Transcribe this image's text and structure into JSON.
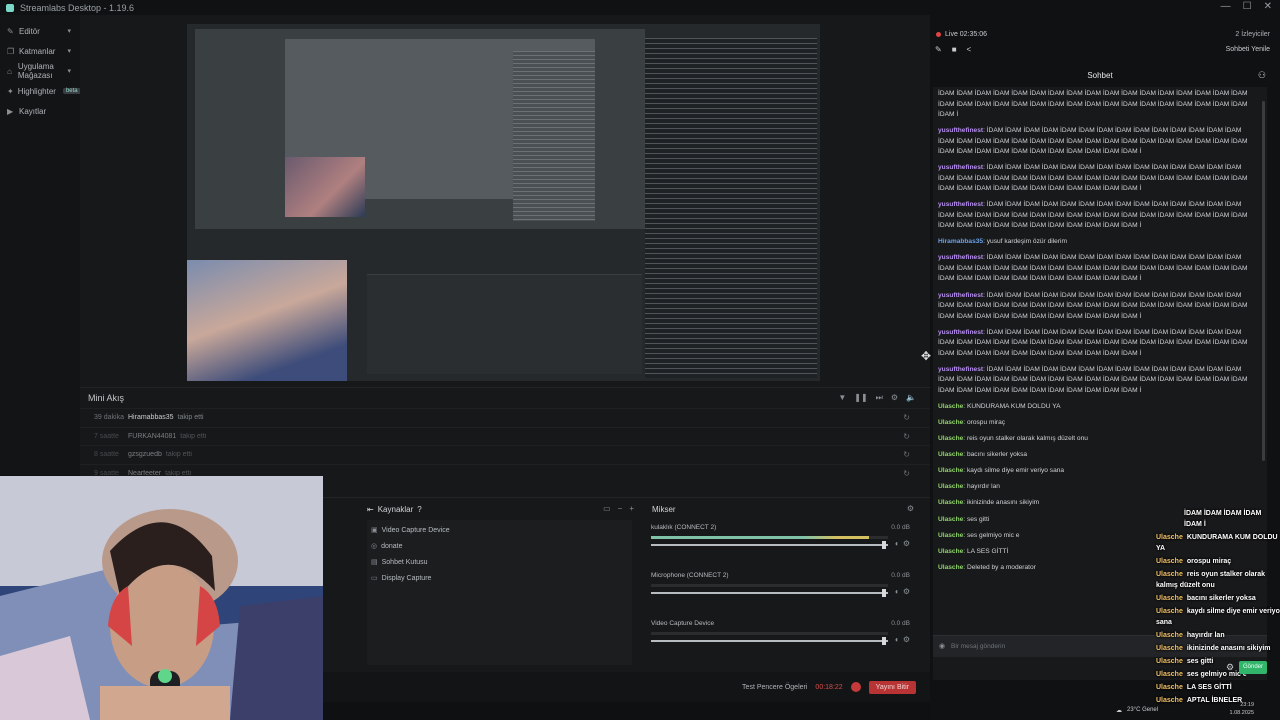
{
  "window": {
    "title": "Streamlabs Desktop - 1.19.6",
    "controls": [
      "—",
      "☐",
      "✕"
    ]
  },
  "nav": {
    "items": [
      {
        "label": "Editör",
        "icon": "pencil-icon",
        "chevron": true
      },
      {
        "label": "Katmanlar",
        "icon": "layers-icon",
        "chevron": true
      },
      {
        "label": "Uygulama Mağazası",
        "icon": "store-icon",
        "chevron": true
      },
      {
        "label": "Highlighter",
        "icon": "highlighter-icon",
        "badge": "beta"
      },
      {
        "label": "Kayıtlar",
        "icon": "recordings-icon"
      }
    ]
  },
  "minifeed": {
    "title": "Mini Akış",
    "rows": [
      {
        "time": "39 dakika",
        "name": "Hiramabbas35",
        "action": "takip etti"
      },
      {
        "time": "7 saatte",
        "name": "FURKAN44081",
        "action": "takip etti"
      },
      {
        "time": "8 saatte",
        "name": "gzsgzuedb",
        "action": "takip etti"
      },
      {
        "time": "9 saatte",
        "name": "Nearfeeter",
        "action": "takip etti"
      }
    ]
  },
  "sources": {
    "title": "Kaynaklar",
    "items": [
      {
        "label": "Video Capture Device",
        "icon": "camera-icon"
      },
      {
        "label": "donate",
        "icon": "donate-icon"
      },
      {
        "label": "Sohbet Kutusu",
        "icon": "chat-icon"
      },
      {
        "label": "Display Capture",
        "icon": "monitor-icon"
      }
    ]
  },
  "mixer": {
    "title": "Mikser",
    "channels": [
      {
        "label": "kulaklık (CONNECT 2)",
        "db": "0.0 dB",
        "level": 0.92
      },
      {
        "label": "Microphone (CONNECT 2)",
        "db": "0.0 dB",
        "level": 0.0
      },
      {
        "label": "Video Capture Device",
        "db": "0.0 dB",
        "level": 0.0
      }
    ]
  },
  "footer": {
    "test_label": "Test Pencere Ögeleri",
    "timer": "00:18:22",
    "end_label": "Yayını Bitir"
  },
  "chat": {
    "live": "Live 02:35:06",
    "viewers": "2 İzleyiciler",
    "refresh": "Sohbeti Yenile",
    "title": "Sohbet",
    "input_placeholder": "Bir mesaj gönderin",
    "messages": [
      {
        "user": "",
        "text": "İDAM İDAM İDAM İDAM İDAM İDAM İDAM İDAM İDAM İDAM İDAM İDAM İDAM İDAM İDAM İDAM İDAM İDAM İDAM İDAM İDAM İDAM İDAM İDAM İDAM İDAM İDAM İDAM İDAM İDAM İDAM İDAM İDAM İDAM İDAM İ",
        "color": "#d0d3d6"
      },
      {
        "user": "yusufthefinest",
        "text": ": İDAM İDAM İDAM İDAM İDAM İDAM İDAM İDAM İDAM İDAM İDAM İDAM İDAM İDAM İDAM İDAM İDAM İDAM İDAM İDAM İDAM İDAM İDAM İDAM İDAM İDAM İDAM İDAM İDAM İDAM İDAM İDAM İDAM İDAM İDAM İDAM İDAM İDAM İDAM İDAM İDAM İDAM İ",
        "color": "#b58cf0"
      },
      {
        "user": "yusufthefinest",
        "text": ": İDAM İDAM İDAM İDAM İDAM İDAM İDAM İDAM İDAM İDAM İDAM İDAM İDAM İDAM İDAM İDAM İDAM İDAM İDAM İDAM İDAM İDAM İDAM İDAM İDAM İDAM İDAM İDAM İDAM İDAM İDAM İDAM İDAM İDAM İDAM İDAM İDAM İDAM İDAM İDAM İDAM İDAM İ",
        "color": "#b58cf0"
      },
      {
        "user": "yusufthefinest",
        "text": ": İDAM İDAM İDAM İDAM İDAM İDAM İDAM İDAM İDAM İDAM İDAM İDAM İDAM İDAM İDAM İDAM İDAM İDAM İDAM İDAM İDAM İDAM İDAM İDAM İDAM İDAM İDAM İDAM İDAM İDAM İDAM İDAM İDAM İDAM İDAM İDAM İDAM İDAM İDAM İDAM İDAM İDAM İ",
        "color": "#b58cf0"
      },
      {
        "user": "Hiramabbas35",
        "text": ": yusuf kardeşim özür dilerim",
        "color": "#6aa3e8"
      },
      {
        "user": "yusufthefinest",
        "text": ": İDAM İDAM İDAM İDAM İDAM İDAM İDAM İDAM İDAM İDAM İDAM İDAM İDAM İDAM İDAM İDAM İDAM İDAM İDAM İDAM İDAM İDAM İDAM İDAM İDAM İDAM İDAM İDAM İDAM İDAM İDAM İDAM İDAM İDAM İDAM İDAM İDAM İDAM İDAM İDAM İDAM İDAM İ",
        "color": "#b58cf0"
      },
      {
        "user": "yusufthefinest",
        "text": ": İDAM İDAM İDAM İDAM İDAM İDAM İDAM İDAM İDAM İDAM İDAM İDAM İDAM İDAM İDAM İDAM İDAM İDAM İDAM İDAM İDAM İDAM İDAM İDAM İDAM İDAM İDAM İDAM İDAM İDAM İDAM İDAM İDAM İDAM İDAM İDAM İDAM İDAM İDAM İDAM İDAM İDAM İ",
        "color": "#b58cf0"
      },
      {
        "user": "yusufthefinest",
        "text": ": İDAM İDAM İDAM İDAM İDAM İDAM İDAM İDAM İDAM İDAM İDAM İDAM İDAM İDAM İDAM İDAM İDAM İDAM İDAM İDAM İDAM İDAM İDAM İDAM İDAM İDAM İDAM İDAM İDAM İDAM İDAM İDAM İDAM İDAM İDAM İDAM İDAM İDAM İDAM İDAM İDAM İDAM İ",
        "color": "#b58cf0"
      },
      {
        "user": "yusufthefinest",
        "text": ": İDAM İDAM İDAM İDAM İDAM İDAM İDAM İDAM İDAM İDAM İDAM İDAM İDAM İDAM İDAM İDAM İDAM İDAM İDAM İDAM İDAM İDAM İDAM İDAM İDAM İDAM İDAM İDAM İDAM İDAM İDAM İDAM İDAM İDAM İDAM İDAM İDAM İDAM İDAM İDAM İDAM İDAM İ",
        "color": "#b58cf0"
      },
      {
        "user": "Ulasche",
        "text": ": KUNDURAMA KUM DOLDU YA",
        "color": "#8fd36a"
      },
      {
        "user": "Ulasche",
        "text": ": orospu miraç",
        "color": "#8fd36a"
      },
      {
        "user": "Ulasche",
        "text": ": reis oyun stalker olarak kalmış düzelt onu",
        "color": "#8fd36a"
      },
      {
        "user": "Ulasche",
        "text": ": bacını sikerler yoksa",
        "color": "#8fd36a"
      },
      {
        "user": "Ulasche",
        "text": ": kaydı silme diye emir veriyo sana",
        "color": "#8fd36a"
      },
      {
        "user": "Ulasche",
        "text": ": hayırdır lan",
        "color": "#8fd36a"
      },
      {
        "user": "Ulasche",
        "text": ": ikinizinde anasını sikiyim",
        "color": "#8fd36a"
      },
      {
        "user": "Ulasche",
        "text": ": ses gitti",
        "color": "#8fd36a"
      },
      {
        "user": "Ulasche",
        "text": ": ses gelmiyo mic e",
        "color": "#8fd36a"
      },
      {
        "user": "Ulasche",
        "text": ": LA SES GİTTİ",
        "color": "#8fd36a"
      },
      {
        "user": "Ulasche",
        "text": ": Deleted by a moderator",
        "color": "#8fd36a"
      }
    ]
  },
  "overlay_chat": {
    "lead": "İDAM İDAM İDAM İDAM İDAM İ",
    "messages": [
      {
        "user": "Ulasche",
        "text": "KUNDURAMA KUM DOLDU YA"
      },
      {
        "user": "Ulasche",
        "text": "orospu miraç"
      },
      {
        "user": "Ulasche",
        "text": "reis oyun stalker olarak kalmış düzelt onu"
      },
      {
        "user": "Ulasche",
        "text": "bacını sikerler yoksa"
      },
      {
        "user": "Ulasche",
        "text": "kaydı silme diye emir veriyo sana"
      },
      {
        "user": "Ulasche",
        "text": "hayırdır lan"
      },
      {
        "user": "Ulasche",
        "text": "ikinizinde anasını sikiyim"
      },
      {
        "user": "Ulasche",
        "text": "ses gitti"
      },
      {
        "user": "Ulasche",
        "text": "ses gelmiyo mic e"
      },
      {
        "user": "Ulasche",
        "text": "LA SES GİTTİ"
      },
      {
        "user": "Ulasche",
        "text": "APTAL İBNELER"
      }
    ],
    "send_label": "Gönder"
  },
  "tray": {
    "weather": "23°C Genel",
    "time": "23:19",
    "date": "1.08.2025"
  }
}
